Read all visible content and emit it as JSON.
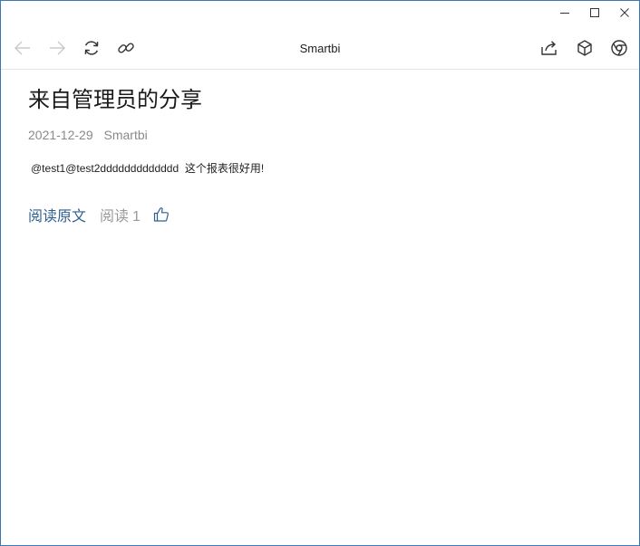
{
  "window": {
    "controls": {
      "minimize_icon": "minimize-icon",
      "maximize_icon": "maximize-icon",
      "close_icon": "close-icon"
    }
  },
  "toolbar": {
    "title": "Smartbi",
    "icons": [
      "back-arrow-icon",
      "forward-arrow-icon",
      "refresh-icon",
      "link-icon",
      "share-icon",
      "cube-icon",
      "chrome-icon"
    ]
  },
  "article": {
    "title": "来自管理员的分享",
    "date": "2021-12-29",
    "author": "Smartbi",
    "body": "@test1@test2ddddddddddddd  这个报表很好用!",
    "read_original_label": "阅读原文",
    "read_count_label": "阅读",
    "read_count": "1"
  },
  "colors": {
    "window_border": "#3c78b4",
    "link": "#2f5f8f",
    "muted": "#8a8a8a",
    "disabled_icon": "#c8c8c8",
    "icon": "#333333"
  }
}
